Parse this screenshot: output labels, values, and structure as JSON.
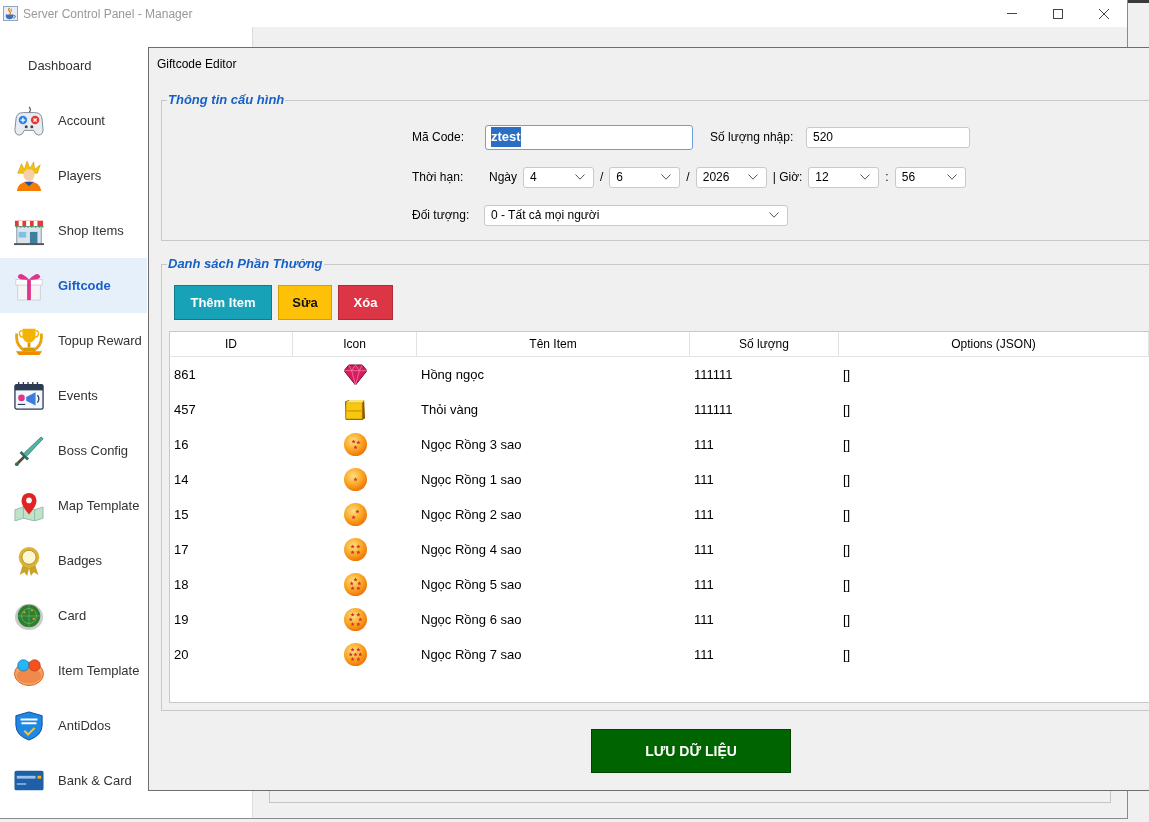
{
  "window": {
    "title": "Server Control Panel - Manager"
  },
  "sidebar": {
    "items": [
      {
        "label": "Dashboard",
        "selected": false
      },
      {
        "label": "Account",
        "selected": false
      },
      {
        "label": "Players",
        "selected": false
      },
      {
        "label": "Shop Items",
        "selected": false
      },
      {
        "label": "Giftcode",
        "selected": true
      },
      {
        "label": "Topup Reward",
        "selected": false
      },
      {
        "label": "Events",
        "selected": false
      },
      {
        "label": "Boss Config",
        "selected": false
      },
      {
        "label": "Map Template",
        "selected": false
      },
      {
        "label": "Badges",
        "selected": false
      },
      {
        "label": "Card",
        "selected": false
      },
      {
        "label": "Item Template",
        "selected": false
      },
      {
        "label": "AntiDdos",
        "selected": false
      },
      {
        "label": "Bank & Card",
        "selected": false
      }
    ]
  },
  "dialog": {
    "title": "Giftcode Editor",
    "config_group": {
      "title": "Thông tin cấu hình",
      "code": {
        "label": "Mã Code:",
        "value": "ztest",
        "focused": true,
        "text_selected": true
      },
      "quantity": {
        "label": "Số lượng nhập:",
        "value": "520"
      },
      "expiry": {
        "label": "Thời hạn:",
        "parts": [
          {
            "kind": "text",
            "text": "Ngày"
          },
          {
            "kind": "select",
            "value": "4"
          },
          {
            "kind": "text",
            "text": "/"
          },
          {
            "kind": "select",
            "value": "6"
          },
          {
            "kind": "text",
            "text": "/"
          },
          {
            "kind": "select",
            "value": "2026"
          },
          {
            "kind": "text",
            "text": "| Giờ:"
          },
          {
            "kind": "select",
            "value": "12"
          },
          {
            "kind": "text",
            "text": ":"
          },
          {
            "kind": "select",
            "value": "56"
          }
        ]
      },
      "target": {
        "label": "Đối tượng:",
        "value": "0 - Tất cả mọi người"
      }
    },
    "rewards_group": {
      "title": "Danh sách Phần Thưởng",
      "buttons": [
        {
          "label": "Thêm Item",
          "kind": "add"
        },
        {
          "label": "Sửa",
          "kind": "edit"
        },
        {
          "label": "Xóa",
          "kind": "delete"
        }
      ],
      "table": {
        "columns": [
          "ID",
          "Icon",
          "Tên Item",
          "Số lượng",
          "Options (JSON)"
        ],
        "rows": [
          {
            "id": "861",
            "name": "Hồng ngọc",
            "quantity": "111111",
            "options": "[]"
          },
          {
            "id": "457",
            "name": "Thỏi vàng",
            "quantity": "111111",
            "options": "[]"
          },
          {
            "id": "16",
            "name": "Ngọc Rồng 3 sao",
            "quantity": "111",
            "options": "[]"
          },
          {
            "id": "14",
            "name": "Ngọc Rồng 1 sao",
            "quantity": "111",
            "options": "[]"
          },
          {
            "id": "15",
            "name": "Ngọc Rồng 2 sao",
            "quantity": "111",
            "options": "[]"
          },
          {
            "id": "17",
            "name": "Ngọc Rồng 4 sao",
            "quantity": "111",
            "options": "[]"
          },
          {
            "id": "18",
            "name": "Ngọc Rồng 5 sao",
            "quantity": "111",
            "options": "[]"
          },
          {
            "id": "19",
            "name": "Ngọc Rồng 6 sao",
            "quantity": "111",
            "options": "[]"
          },
          {
            "id": "20",
            "name": "Ngọc Rồng 7 sao",
            "quantity": "111",
            "options": "[]"
          }
        ]
      }
    },
    "save_button": "LƯU DỮ LIỆU"
  }
}
